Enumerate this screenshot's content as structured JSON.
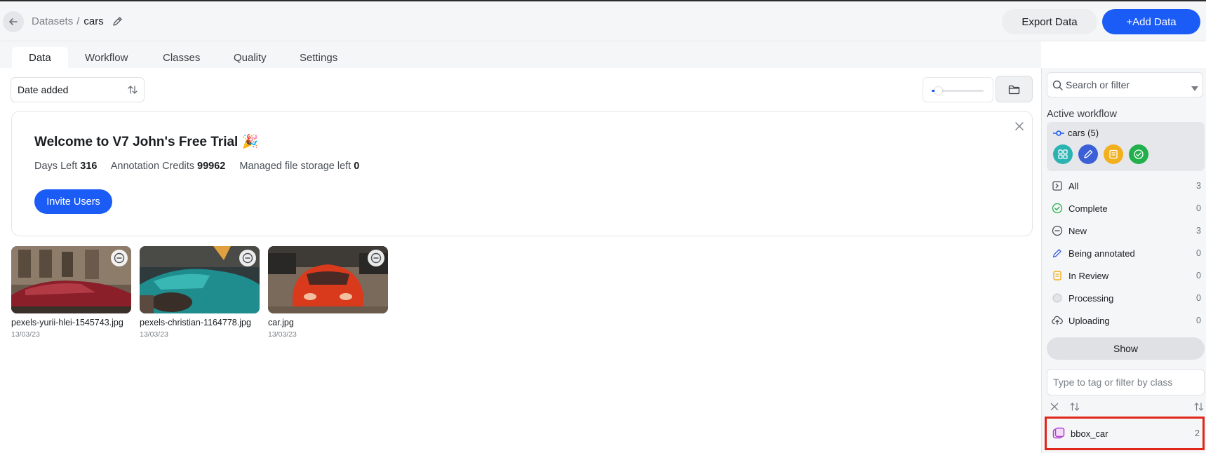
{
  "header": {
    "breadcrumb_parent": "Datasets",
    "breadcrumb_sep": "/",
    "breadcrumb_current": "cars",
    "export_label": "Export Data",
    "add_label": "+Add Data"
  },
  "tabs": [
    {
      "label": "Data",
      "active": true
    },
    {
      "label": "Workflow",
      "active": false
    },
    {
      "label": "Classes",
      "active": false
    },
    {
      "label": "Quality",
      "active": false
    },
    {
      "label": "Settings",
      "active": false
    }
  ],
  "toolbar": {
    "sort_value": "Date added",
    "thumbnail_size_fraction": 0.1
  },
  "welcome": {
    "title": "Welcome to V7 John's Free Trial 🎉",
    "stats": [
      {
        "label": "Days Left",
        "value": "316"
      },
      {
        "label": "Annotation Credits",
        "value": "99962"
      },
      {
        "label": "Managed file storage left",
        "value": "0"
      }
    ],
    "invite_label": "Invite Users"
  },
  "items": [
    {
      "name": "pexels-yurii-hlei-1545743.jpg",
      "date": "13/03/23"
    },
    {
      "name": "pexels-christian-1164778.jpg",
      "date": "13/03/23"
    },
    {
      "name": "car.jpg",
      "date": "13/03/23"
    }
  ],
  "sidebar": {
    "search_placeholder": "Search or filter",
    "workflow_title": "Active workflow",
    "workflow_name": "cars (5)",
    "stage_colors": [
      "#2bb3b1",
      "#3b5fd6",
      "#f2b01e",
      "#21b04b"
    ],
    "statuses": [
      {
        "label": "All",
        "count": "3"
      },
      {
        "label": "Complete",
        "count": "0"
      },
      {
        "label": "New",
        "count": "3"
      },
      {
        "label": "Being annotated",
        "count": "0"
      },
      {
        "label": "In Review",
        "count": "0"
      },
      {
        "label": "Processing",
        "count": "0"
      },
      {
        "label": "Uploading",
        "count": "0"
      }
    ],
    "show_label": "Show",
    "tag_placeholder": "Type to tag or filter by class",
    "classes": [
      {
        "name": "bbox_car",
        "count": "2"
      }
    ]
  },
  "colors": {
    "accent": "#1a5cf5",
    "highlight_border": "#e0261a"
  }
}
